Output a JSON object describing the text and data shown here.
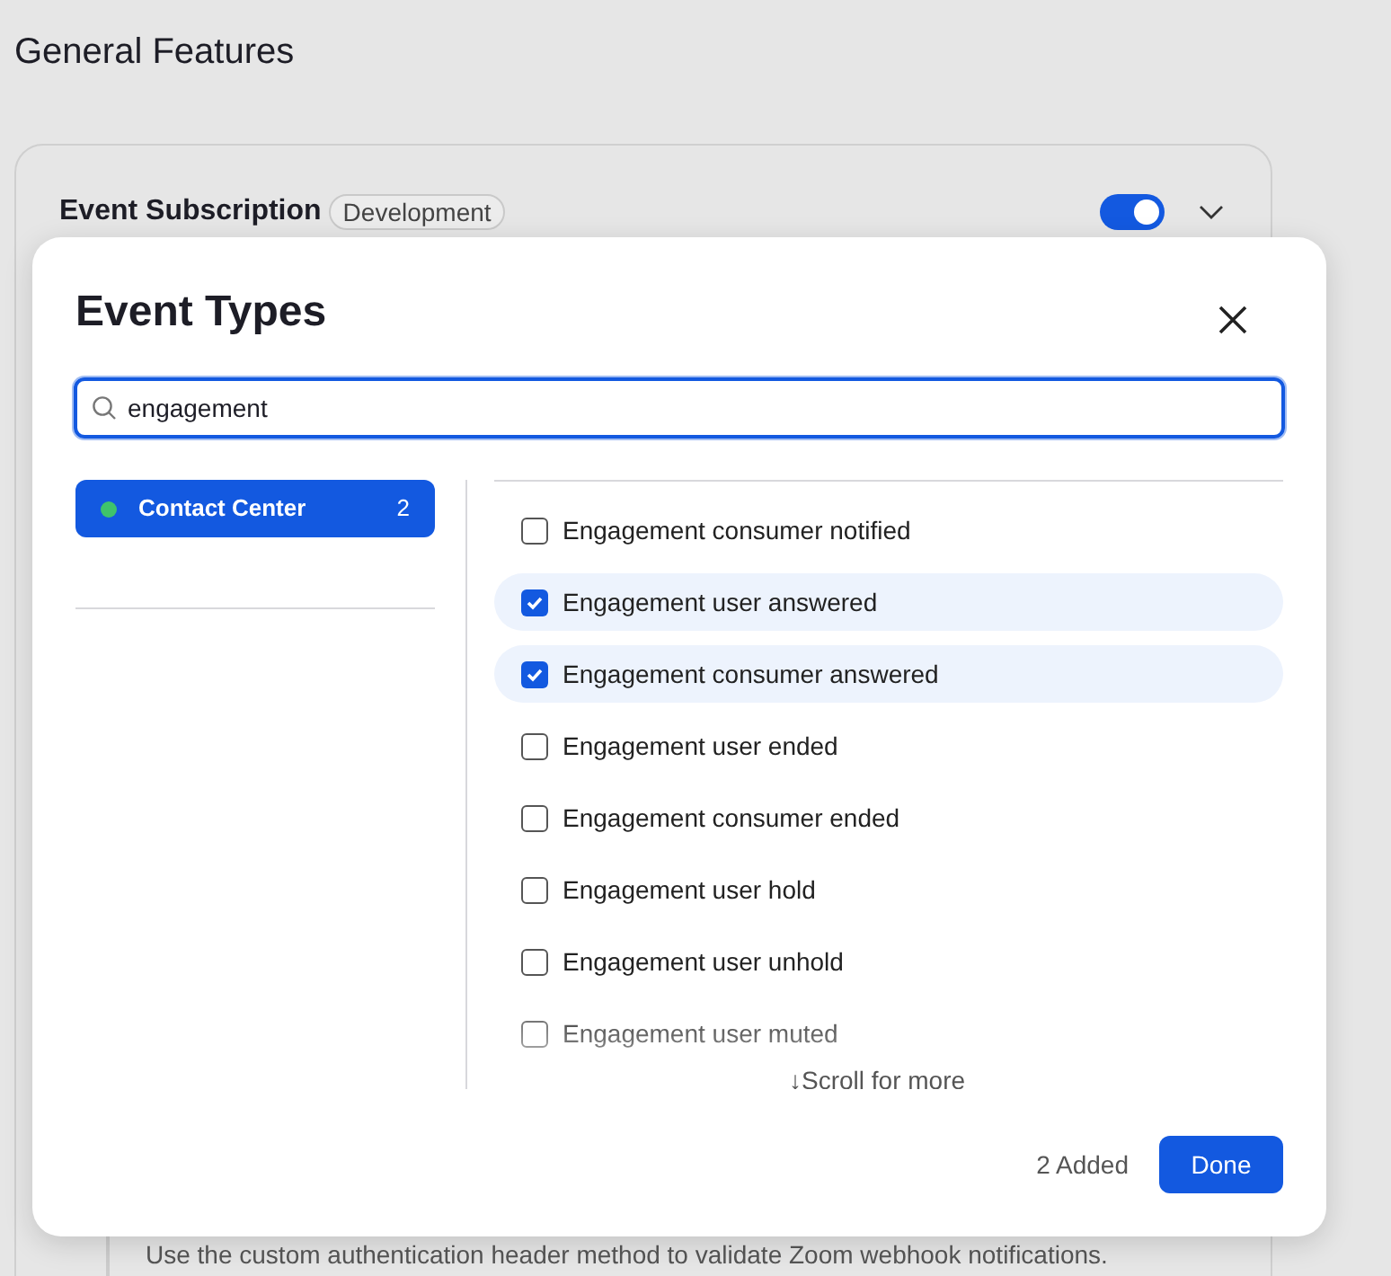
{
  "page_title": "General Features",
  "card": {
    "title": "Event Subscription",
    "badge": "Development",
    "enabled": true,
    "expanded": true,
    "description": "Use the custom authentication header method to validate Zoom webhook notifications."
  },
  "dialog": {
    "title": "Event Types",
    "search": {
      "value": "engagement"
    },
    "categories": [
      {
        "label": "Contact Center",
        "count": "2",
        "color": "#3fc36b",
        "selected": true
      }
    ],
    "events": [
      {
        "label": "Engagement consumer notified",
        "checked": false
      },
      {
        "label": "Engagement user answered",
        "checked": true
      },
      {
        "label": "Engagement consumer answered",
        "checked": true
      },
      {
        "label": "Engagement user ended",
        "checked": false
      },
      {
        "label": "Engagement consumer ended",
        "checked": false
      },
      {
        "label": "Engagement user hold",
        "checked": false
      },
      {
        "label": "Engagement user unhold",
        "checked": false
      },
      {
        "label": "Engagement user muted",
        "checked": false
      }
    ],
    "scroll_hint": "↓Scroll for more",
    "added": "2 Added",
    "done": "Done"
  }
}
